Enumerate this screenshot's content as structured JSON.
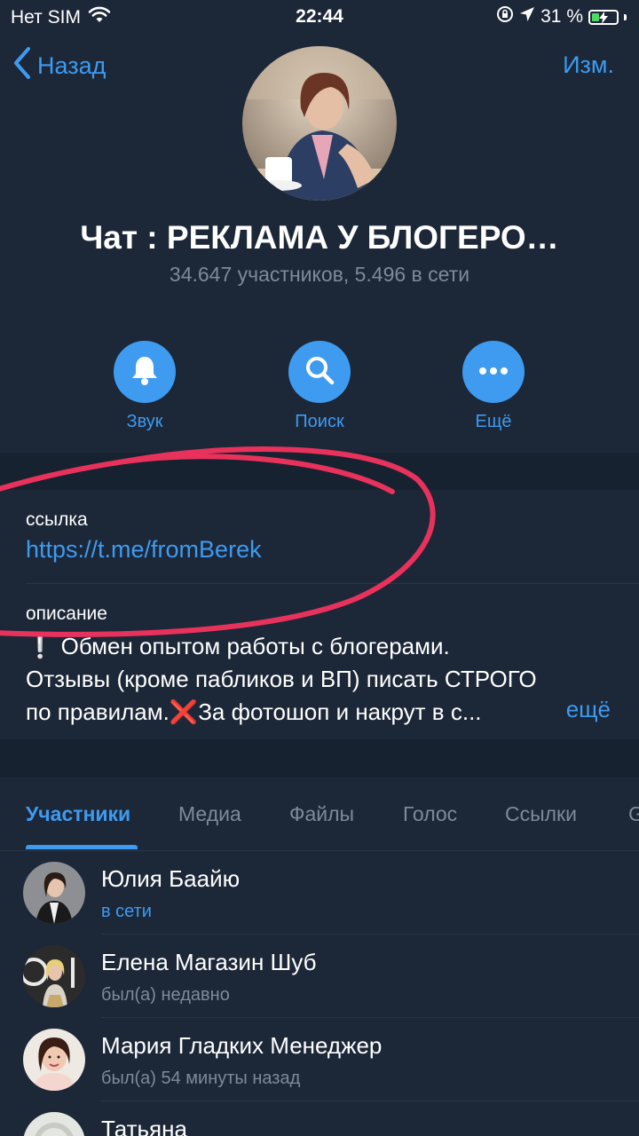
{
  "status_bar": {
    "carrier": "Нет SIM",
    "time": "22:44",
    "battery": "31 %",
    "battery_level": 0.31
  },
  "header": {
    "back_label": "Назад",
    "edit_label": "Изм."
  },
  "chat": {
    "title": "Чат : РЕКЛАМА У БЛОГЕРО…",
    "subtitle": "34.647 участников, 5.496 в сети"
  },
  "actions": [
    {
      "label": "Звук",
      "icon": "bell-icon"
    },
    {
      "label": "Поиск",
      "icon": "search-icon"
    },
    {
      "label": "Ещё",
      "icon": "more-icon"
    }
  ],
  "info": {
    "link_label": "ссылка",
    "link": "https://t.me/fromBerek",
    "description_label": "описание",
    "description_lines": [
      "❕ Обмен опытом работы с блогерами.",
      "Отзывы (кроме пабликов и ВП) писать СТРОГО",
      "по правилам.❌За фотошоп и накрут в с..."
    ],
    "more_label": "ещё"
  },
  "tabs": [
    {
      "label": "Участники",
      "active": true
    },
    {
      "label": "Медиа",
      "active": false
    },
    {
      "label": "Файлы",
      "active": false
    },
    {
      "label": "Голос",
      "active": false
    },
    {
      "label": "Ссылки",
      "active": false
    },
    {
      "label": "G",
      "active": false
    }
  ],
  "members": [
    {
      "name": "Юлия Баайю",
      "status": "в сети",
      "online": true
    },
    {
      "name": "Елена Магазин Шуб",
      "status": "был(а) недавно",
      "online": false
    },
    {
      "name": "Мария Гладких Менеджер",
      "status": "был(а) 54 минуты назад",
      "online": false
    },
    {
      "name": "Татьяна",
      "status": "",
      "online": false
    }
  ],
  "colors": {
    "background": "#1c2738",
    "accent": "#3e9bf0",
    "annotation": "#e8325c"
  }
}
